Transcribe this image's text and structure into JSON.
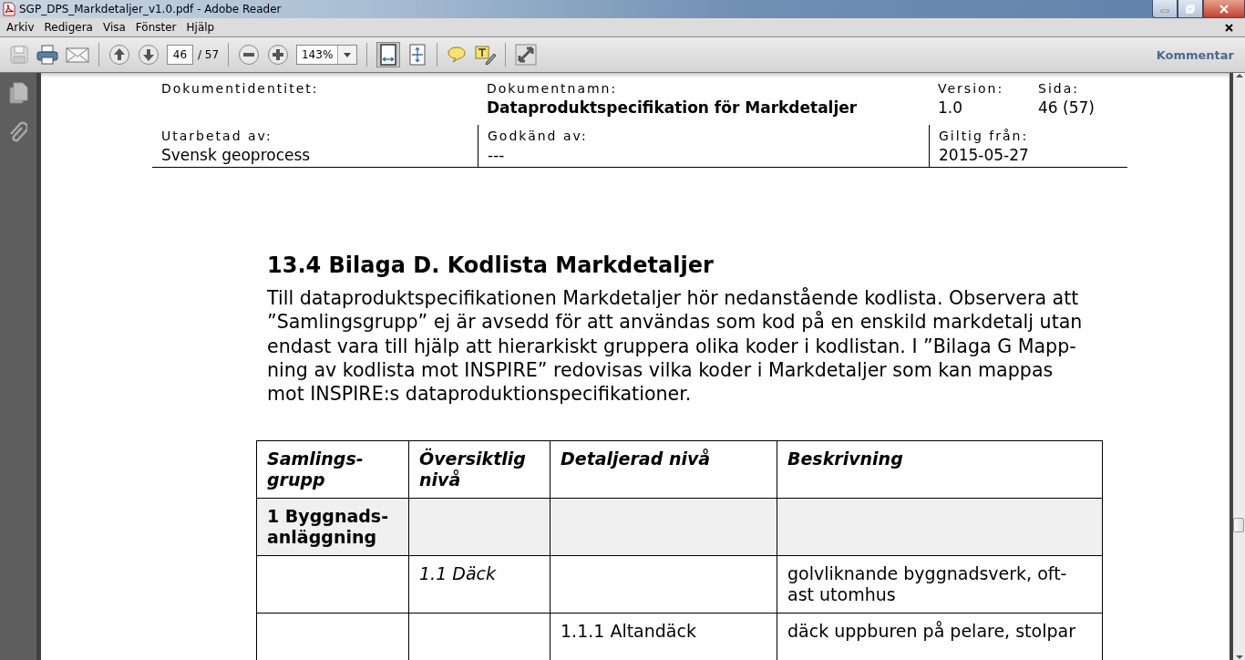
{
  "window": {
    "title": "SGP_DPS_Markdetaljer_v1.0.pdf - Adobe Reader"
  },
  "menu": [
    "Arkiv",
    "Redigera",
    "Visa",
    "Fönster",
    "Hjälp"
  ],
  "toolbar": {
    "page_number": "46",
    "page_count": "/ 57",
    "zoom": "143%",
    "comment_button": "Kommentar"
  },
  "document": {
    "header": [
      [
        {
          "label": "Dokumentidentitet:"
        },
        {
          "label": "Dokumentnamn:",
          "value": "Dataproduktspecifikation för Markdetaljer",
          "emphasis": true
        },
        {
          "label": "Version:",
          "value": "1.0",
          "emphasis": false
        },
        {
          "label": "Sida:",
          "value": "46 (57)",
          "emphasis": false
        }
      ],
      [
        {
          "label": "Utarbetad av:",
          "value": "Svensk geoprocess",
          "emphasis": false
        },
        {
          "label": "Godkänd av:",
          "value": "---",
          "emphasis": false
        },
        {
          "label": "Giltig från:",
          "value": "2015-05-27",
          "emphasis": false
        }
      ]
    ],
    "heading": "13.4 Bilaga D. Kodlista Markdetaljer",
    "paragraph_lines": [
      "Till dataproduktspecifikationen Markdetaljer hör nedanstående kodlista. Observera att",
      "”Samlingsgrupp” ej är avsedd för att användas som kod på en enskild markdetalj utan",
      "endast vara till hjälp att hierarkiskt gruppera olika koder i kodlistan. I ”Bilaga G Mapp-",
      "ning av kodlista mot INSPIRE” redovisas vilka koder i Markdetaljer som kan mappas",
      "mot INSPIRE:s dataproduktionspecifikationer."
    ],
    "table": {
      "columns": [
        "Samlings-\ngrupp",
        "Översiktlig\nnivå",
        "Detaljerad nivå",
        "Beskrivning"
      ],
      "rows": [
        {
          "kind": "group",
          "group": "1 Byggnads-\nanläggning"
        },
        {
          "kind": "overview",
          "overview": "1.1 Däck",
          "description": "golvliknande byggnadsverk, oft-\nast utomhus"
        },
        {
          "kind": "detail",
          "detail": "1.1.1 Altandäck",
          "description": "däck uppburen på pelare, stolpar"
        }
      ]
    }
  }
}
